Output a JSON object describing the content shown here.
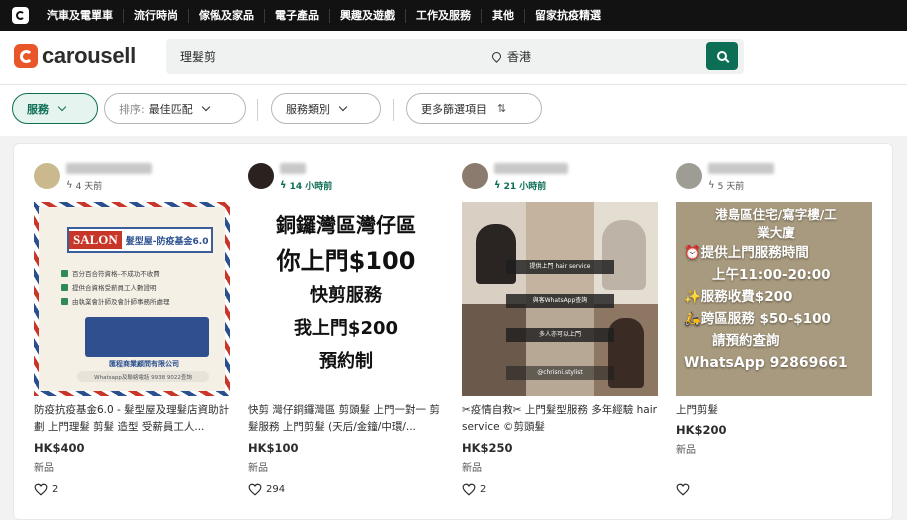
{
  "topnav": {
    "items": [
      "汽車及電單車",
      "流行時尚",
      "傢俬及家品",
      "電子產品",
      "興趣及遊戲",
      "工作及服務",
      "其他",
      "留家抗疫精選"
    ]
  },
  "header": {
    "brand": "carousell",
    "search_value": "理髮剪",
    "location": "香港"
  },
  "filters": {
    "service": "服務",
    "sort_label": "排序:",
    "sort_value": "最佳匹配",
    "category": "服務類別",
    "more": "更多篩選項目"
  },
  "listings": [
    {
      "time": "4 天前",
      "time_new": false,
      "title": "防疫抗疫基金6.0 - 髮型屋及理髮店資助計劃 上門理髮 剪髮 造型 受薪員工人...",
      "price": "HK$400",
      "condition": "新品",
      "likes": "2",
      "poster": {
        "brand": "SALON",
        "brand_sub": "髮型屋-防疫基金6.0",
        "lines": [
          "百分百合符資格–不成功不收費",
          "提供合資格受薪員工人數證明",
          "由執業會計師及會計師事務所處理"
        ],
        "company": "匯程商業顧問有限公司",
        "whatsapp": "Whatsapp及聯絡電話 9938 9022查詢"
      }
    },
    {
      "time": "14 小時前",
      "time_new": true,
      "title": "快剪 灣仔銅鑼灣區 剪頭髮 上門一對一 剪髮服務 上門剪髮 (天后/金鐘/中環/...",
      "price": "HK$100",
      "condition": "新品",
      "likes": "294",
      "poster": {
        "lines": [
          "銅鑼灣區灣仔區",
          "你上門$100",
          "快剪服務",
          "我上門$200",
          "預約制"
        ]
      }
    },
    {
      "time": "21 小時前",
      "time_new": true,
      "title": "✂疫情自救✂ 上門髮型服務 多年經驗 hair service ©剪頭髮",
      "price": "HK$250",
      "condition": "新品",
      "likes": "2",
      "poster": {
        "lines": [
          "提供上門 hair service",
          "與客WhatsApp查詢",
          "多人亦可以上門",
          "@chrisni.stylist"
        ]
      }
    },
    {
      "time": "5 天前",
      "time_new": false,
      "title": "上門剪髮",
      "price": "HK$200",
      "condition": "新品",
      "likes": "",
      "poster": {
        "lines": [
          "港島區住宅/寫字樓/工",
          "業大廈",
          "⏰提供上門服務時間",
          "上午11:00-20:00",
          "✨服務收費$200",
          "🛵跨區服務 $50-$100",
          "請預約查詢",
          "WhatsApp 92869661"
        ]
      }
    }
  ],
  "colors": {
    "accent": "#0d6e56",
    "brand": "#e8562a",
    "topnav": "#121212"
  }
}
